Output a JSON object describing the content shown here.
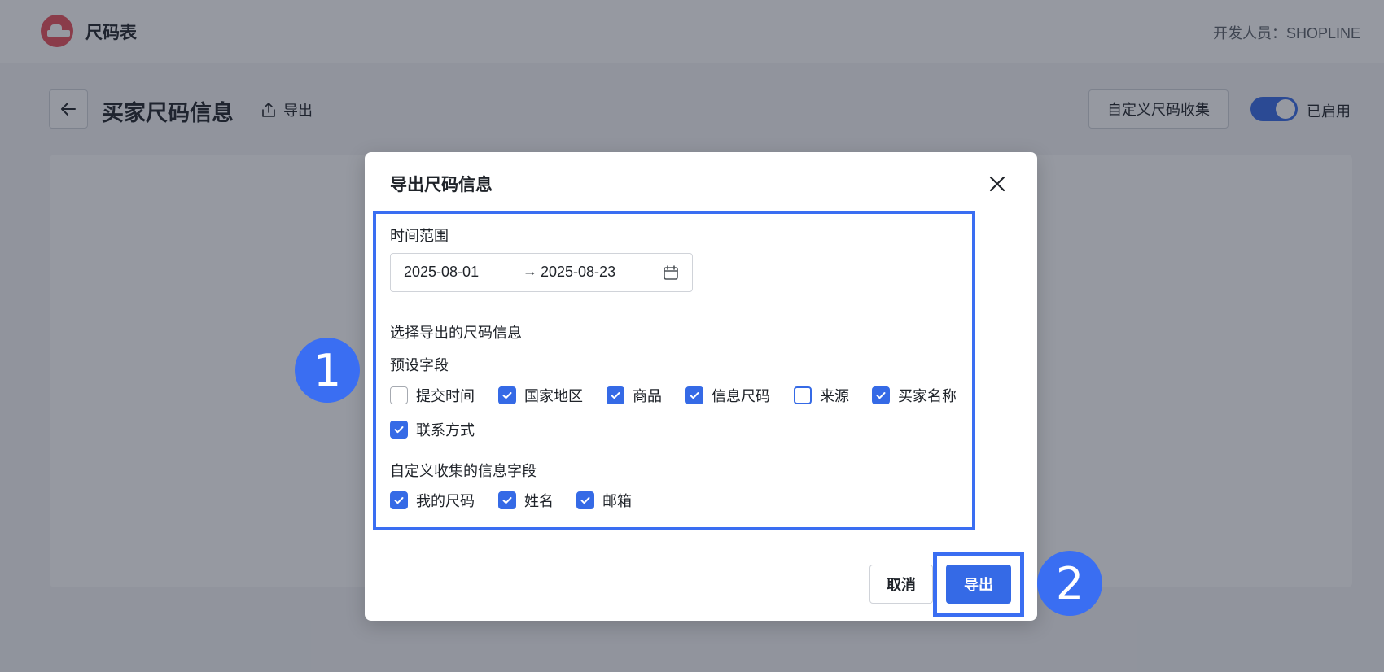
{
  "app": {
    "title": "尺码表",
    "developer": "开发人员：SHOPLINE"
  },
  "page": {
    "title": "买家尺码信息",
    "export_label": "导出",
    "custom_button_label": "自定义尺码收集",
    "toggle_label": "已启用",
    "toggle_on": true
  },
  "modal": {
    "title": "导出尺码信息",
    "time_range_label": "时间范围",
    "date_start": "2025-08-01",
    "date_separator": "→",
    "date_end": "2025-08-23",
    "select_label": "选择导出的尺码信息",
    "preset_label": "预设字段",
    "preset_fields": [
      {
        "label": "提交时间",
        "checked": false
      },
      {
        "label": "国家地区",
        "checked": true
      },
      {
        "label": "商品",
        "checked": true
      },
      {
        "label": "信息尺码",
        "checked": true
      },
      {
        "label": "来源",
        "checked": false
      },
      {
        "label": "买家名称",
        "checked": true
      },
      {
        "label": "联系方式",
        "checked": true
      }
    ],
    "custom_label": "自定义收集的信息字段",
    "custom_fields": [
      {
        "label": "我的尺码",
        "checked": true
      },
      {
        "label": "姓名",
        "checked": true
      },
      {
        "label": "邮箱",
        "checked": true
      }
    ],
    "cancel_label": "取消",
    "export_label": "导出"
  },
  "callouts": [
    "1",
    "2"
  ],
  "colors": {
    "accent": "#356ae6",
    "highlight": "#3a6ef2",
    "logo": "#e8505b"
  }
}
